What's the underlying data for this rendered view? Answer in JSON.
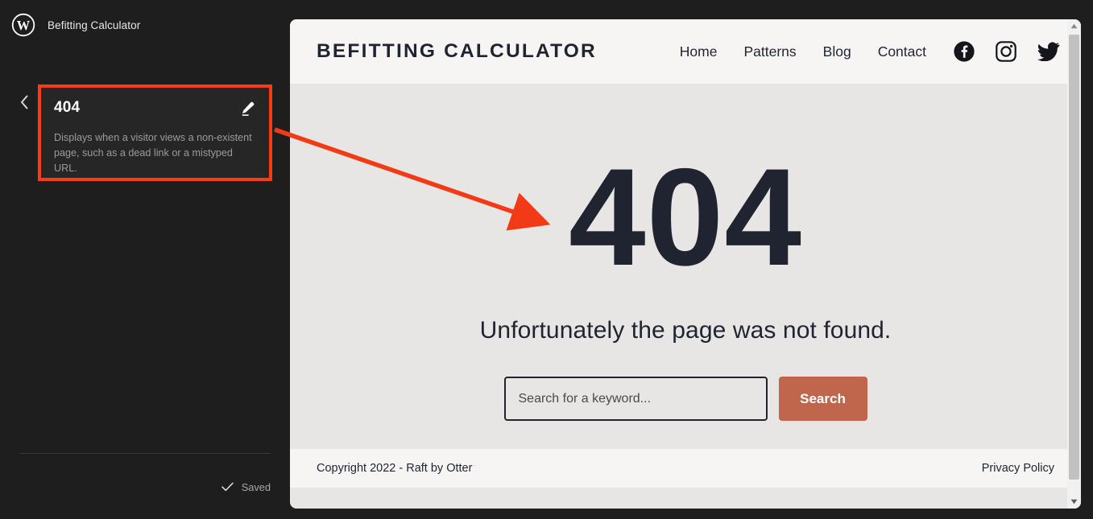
{
  "admin": {
    "logo_icon": "wordpress-logo-icon",
    "site_name": "Befitting Calculator",
    "back_icon": "chevron-left-icon",
    "template_card": {
      "title": "404",
      "description": "Displays when a visitor views a non-existent page, such as a dead link or a mistyped URL.",
      "edit_icon": "pencil-icon",
      "highlight_color": "#fb3b14"
    },
    "status": {
      "check_icon": "check-icon",
      "label": "Saved"
    }
  },
  "preview": {
    "header": {
      "site_title": "BEFITTING CALCULATOR",
      "nav": [
        {
          "label": "Home"
        },
        {
          "label": "Patterns"
        },
        {
          "label": "Blog"
        },
        {
          "label": "Contact"
        }
      ],
      "social": [
        {
          "name": "facebook-icon"
        },
        {
          "name": "instagram-icon"
        },
        {
          "name": "twitter-icon"
        }
      ]
    },
    "body": {
      "error_code": "404",
      "message": "Unfortunately the page was not found.",
      "search_placeholder": "Search for a keyword...",
      "search_value": "",
      "search_button": "Search",
      "search_button_color": "#c0664d"
    },
    "footer": {
      "copyright": "Copyright 2022 - Raft by Otter",
      "privacy": "Privacy Policy"
    }
  },
  "scrollbar": {
    "up_icon": "triangle-up-icon",
    "down_icon": "triangle-down-icon"
  },
  "annotation": {
    "arrow_color": "#f23a16"
  }
}
